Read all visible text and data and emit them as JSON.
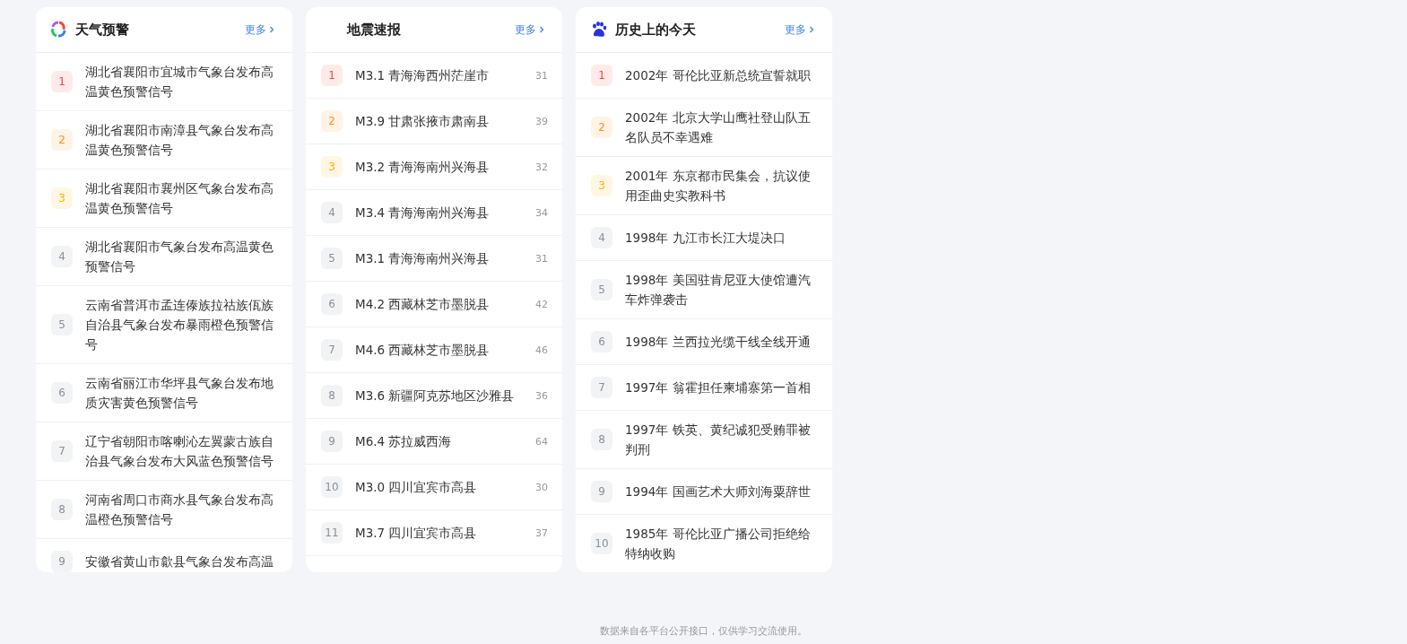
{
  "cards": [
    {
      "title": "天气预警",
      "more": "更多",
      "items": [
        {
          "rank": "1",
          "color": "#f5483b",
          "text": "湖北省襄阳市宜城市气象台发布高温黄色预警信号"
        },
        {
          "rank": "2",
          "color": "#ff8f1f",
          "text": "湖北省襄阳市南漳县气象台发布高温黄色预警信号"
        },
        {
          "rank": "3",
          "color": "#ffb300",
          "text": "湖北省襄阳市襄州区气象台发布高温黄色预警信号"
        },
        {
          "rank": "4",
          "color": "#8a8f99",
          "text": "湖北省襄阳市气象台发布高温黄色预警信号"
        },
        {
          "rank": "5",
          "color": "#8a8f99",
          "text": "云南省普洱市孟连傣族拉祜族佤族自治县气象台发布暴雨橙色预警信号"
        },
        {
          "rank": "6",
          "color": "#8a8f99",
          "text": "云南省丽江市华坪县气象台发布地质灾害黄色预警信号"
        },
        {
          "rank": "7",
          "color": "#8a8f99",
          "text": "辽宁省朝阳市喀喇沁左翼蒙古族自治县气象台发布大风蓝色预警信号"
        },
        {
          "rank": "8",
          "color": "#8a8f99",
          "text": "河南省周口市商水县气象台发布高温橙色预警信号"
        },
        {
          "rank": "9",
          "color": "#8a8f99",
          "text": "安徽省黄山市歙县气象台发布高温"
        }
      ]
    },
    {
      "title": "地震速报",
      "more": "更多",
      "items": [
        {
          "rank": "1",
          "color": "#f5483b",
          "text": "M3.1 青海海西州茫崖市",
          "count": "31"
        },
        {
          "rank": "2",
          "color": "#ff8f1f",
          "text": "M3.9 甘肃张掖市肃南县",
          "count": "39"
        },
        {
          "rank": "3",
          "color": "#ffb300",
          "text": "M3.2 青海海南州兴海县",
          "count": "32"
        },
        {
          "rank": "4",
          "color": "#8a8f99",
          "text": "M3.4 青海海南州兴海县",
          "count": "34"
        },
        {
          "rank": "5",
          "color": "#8a8f99",
          "text": "M3.1 青海海南州兴海县",
          "count": "31"
        },
        {
          "rank": "6",
          "color": "#8a8f99",
          "text": "M4.2 西藏林芝市墨脱县",
          "count": "42"
        },
        {
          "rank": "7",
          "color": "#8a8f99",
          "text": "M4.6 西藏林芝市墨脱县",
          "count": "46"
        },
        {
          "rank": "8",
          "color": "#8a8f99",
          "text": "M3.6 新疆阿克苏地区沙雅县",
          "count": "36"
        },
        {
          "rank": "9",
          "color": "#8a8f99",
          "text": "M6.4 苏拉威西海",
          "count": "64"
        },
        {
          "rank": "10",
          "color": "#8a8f99",
          "text": "M3.0 四川宜宾市高县",
          "count": "30"
        },
        {
          "rank": "11",
          "color": "#8a8f99",
          "text": "M3.7 四川宜宾市高县",
          "count": "37"
        }
      ]
    },
    {
      "title": "历史上的今天",
      "more": "更多",
      "items": [
        {
          "rank": "1",
          "color": "#f5483b",
          "text": "2002年 哥伦比亚新总统宣誓就职"
        },
        {
          "rank": "2",
          "color": "#ff8f1f",
          "text": "2002年 北京大学山鹰社登山队五名队员不幸遇难"
        },
        {
          "rank": "3",
          "color": "#ffb300",
          "text": "2001年 东京都市民集会，抗议使用歪曲史实教科书"
        },
        {
          "rank": "4",
          "color": "#8a8f99",
          "text": "1998年 九江市长江大堤决口"
        },
        {
          "rank": "5",
          "color": "#8a8f99",
          "text": "1998年 美国驻肯尼亚大使馆遭汽车炸弹袭击"
        },
        {
          "rank": "6",
          "color": "#8a8f99",
          "text": "1998年 兰西拉光缆干线全线开通"
        },
        {
          "rank": "7",
          "color": "#8a8f99",
          "text": "1997年 翁霍担任柬埔寨第一首相"
        },
        {
          "rank": "8",
          "color": "#8a8f99",
          "text": "1997年 铁英、黄纪诚犯受贿罪被判刑"
        },
        {
          "rank": "9",
          "color": "#8a8f99",
          "text": "1994年 国画艺术大师刘海粟辞世"
        },
        {
          "rank": "10",
          "color": "#8a8f99",
          "text": "1985年 哥伦比亚广播公司拒绝给特纳收购"
        }
      ]
    }
  ],
  "footer": "数据来自各平台公开接口，仅供学习交流使用。"
}
